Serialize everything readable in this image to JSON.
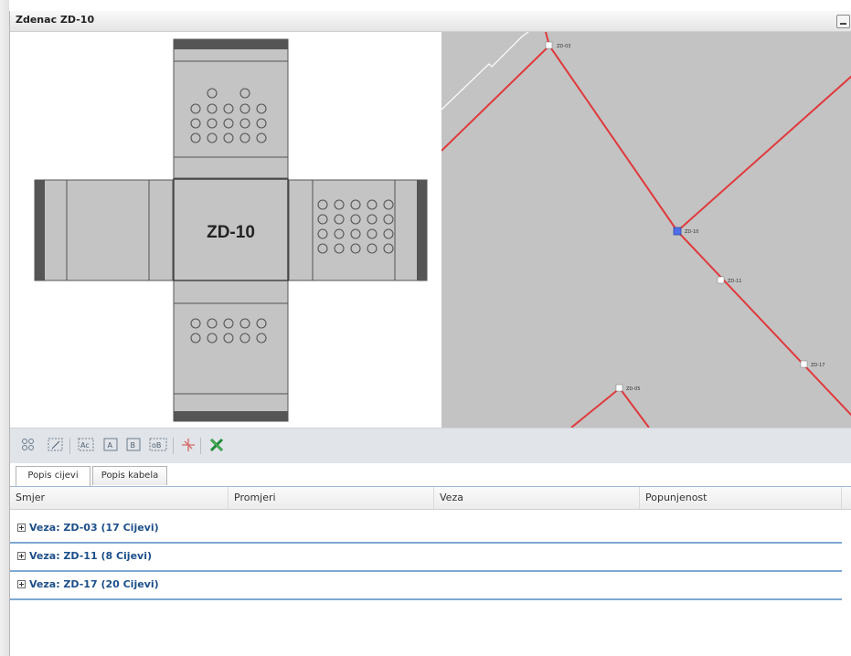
{
  "window": {
    "title": "Zdenac ZD-10"
  },
  "diagram": {
    "label": "ZD-10"
  },
  "map": {
    "node_labels": [
      "ZD-03",
      "ZD-10",
      "ZD-11",
      "ZD-17",
      "ZD-05"
    ],
    "colors": {
      "cable": "#e0393c",
      "background": "#c3c3c3",
      "selected_node": "#4f6fe8"
    }
  },
  "toolbar": {
    "buttons": [
      "grid-icon",
      "select-icon",
      "label-a-c-icon",
      "label-a-icon",
      "label-b-icon",
      "label-d-b-icon",
      "split-icon",
      "excel-export-icon"
    ]
  },
  "tabs": [
    {
      "label": "Popis cijevi",
      "active": true
    },
    {
      "label": "Popis kabela",
      "active": false
    }
  ],
  "table": {
    "columns": [
      "Smjer",
      "Promjeri",
      "Veza",
      "Popunjenost"
    ],
    "groups": [
      {
        "label": "Veza: ZD-03 (17 Cijevi)"
      },
      {
        "label": "Veza: ZD-11 (8 Cijevi)"
      },
      {
        "label": "Veza: ZD-17 (20 Cijevi)"
      }
    ]
  }
}
